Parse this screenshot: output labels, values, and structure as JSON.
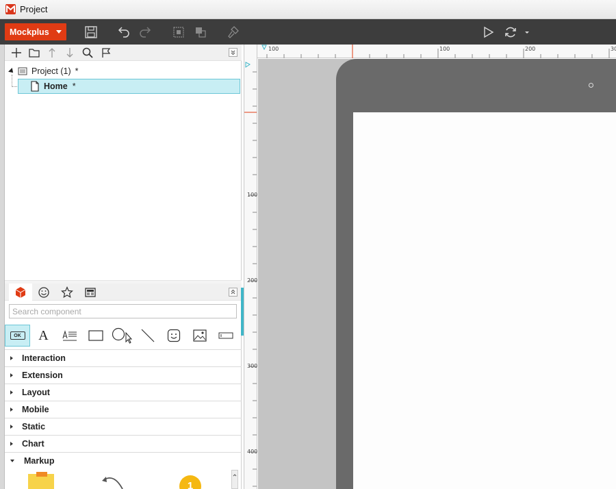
{
  "window": {
    "title": "Project"
  },
  "toolbar": {
    "brand_label": "Mockplus",
    "colors": {
      "brand": "#e03b14",
      "bar": "#3d3d3d"
    },
    "icons": [
      "save-icon",
      "undo-icon",
      "redo-icon",
      "group-icon",
      "ungroup-icon",
      "format-brush-icon",
      "play-icon",
      "sync-icon",
      "dropdown-icon"
    ]
  },
  "pages_panel": {
    "icons": [
      "add-icon",
      "folder-icon",
      "move-up-icon",
      "move-down-icon",
      "search-icon",
      "flag-icon",
      "collapse-icon"
    ],
    "tree": {
      "project_label": "Project (1)",
      "project_marker": "*",
      "home_label": "Home",
      "home_marker": "*"
    }
  },
  "components_panel": {
    "tabs": [
      "components-icon",
      "emoji-icon",
      "star-icon",
      "template-icon"
    ],
    "search": {
      "placeholder": "Search component",
      "value": ""
    },
    "basic_components": [
      "button-component",
      "text-component",
      "paragraph-component",
      "rectangle-component",
      "circle-component",
      "line-component",
      "smiley-component",
      "image-component",
      "input-component"
    ],
    "button_component_label": "OK",
    "text_component_label": "A",
    "categories": [
      {
        "label": "Interaction",
        "open": false
      },
      {
        "label": "Extension",
        "open": false
      },
      {
        "label": "Layout",
        "open": false
      },
      {
        "label": "Mobile",
        "open": false
      },
      {
        "label": "Static",
        "open": false
      },
      {
        "label": "Chart",
        "open": false
      },
      {
        "label": "Markup",
        "open": true
      }
    ],
    "markup_badge": "1"
  },
  "canvas": {
    "h_ruler_labels": [
      "100",
      "100",
      "200",
      "30"
    ],
    "v_ruler_labels": [
      "100",
      "200",
      "300",
      "400"
    ],
    "colors": {
      "background": "#c4c4c4",
      "device": "#6a6a6a",
      "screen": "#fdfdfd",
      "accent": "#3fb6c8"
    }
  }
}
